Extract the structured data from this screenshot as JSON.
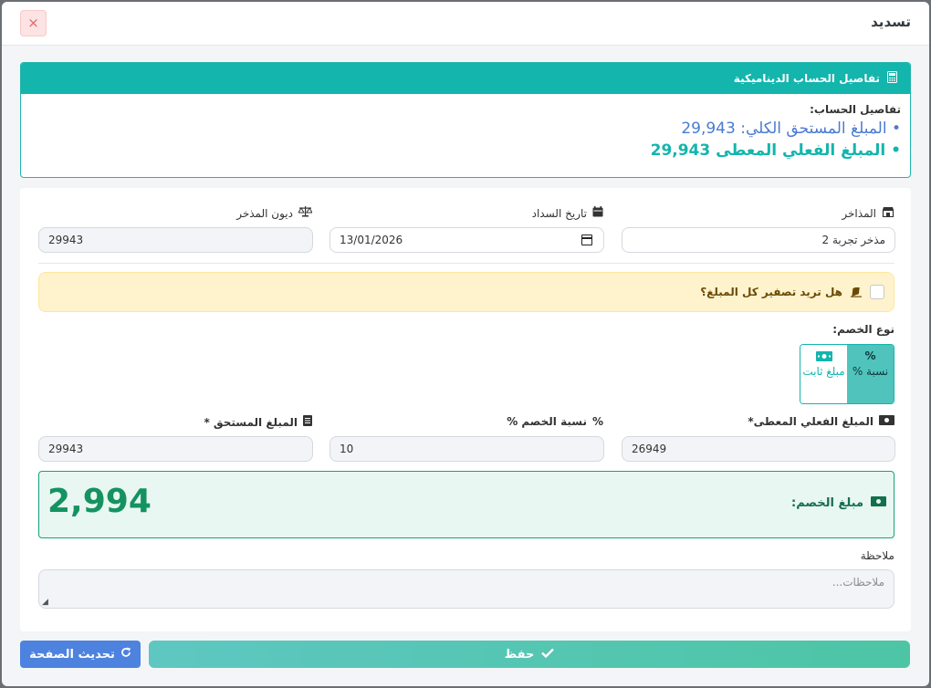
{
  "modal": {
    "title": "تسديد",
    "close_symbol": "×"
  },
  "calculation": {
    "header": "تفاصيل الحساب الديناميكية",
    "label": "تفاصيل الحساب:",
    "total_due_line": "• المبلغ المستحق الكلي: 29,943",
    "actual_given_line": "• المبلغ الفعلي المعطى 29,943"
  },
  "form": {
    "store": {
      "label": "المذاخر",
      "value": "مذخر تجربة 2"
    },
    "payment_date": {
      "label": "تاريخ السداد",
      "value": "13/01/2026"
    },
    "store_debts": {
      "label": "ديون المذخر",
      "value": "29943"
    },
    "zero_question": "هل تريد تصفير كل المبلغ؟",
    "discount_type": {
      "label": "نوع الخصم:",
      "options": [
        {
          "icon_text": "%",
          "label": "نسبة %",
          "active": true
        },
        {
          "icon_text": "▭",
          "label": "مبلغ ثابت",
          "active": false
        }
      ]
    },
    "actual_given": {
      "label": "المبلغ الفعلي المعطى*",
      "value": "26949"
    },
    "discount_percent": {
      "label": "نسبة الخصم %",
      "value": "10"
    },
    "amount_due": {
      "label": "المبلغ المستحق *",
      "value": "29943"
    },
    "discount_amount": {
      "label": "مبلغ الخصم:",
      "value": "2,994"
    },
    "notes": {
      "label": "ملاحظة",
      "placeholder": "ملاحظات..."
    }
  },
  "buttons": {
    "save": "حفظ",
    "refresh": "تحديث الصفحة"
  },
  "colors": {
    "teal": "#13b5ad",
    "green": "#149361",
    "blue": "#4d82df",
    "warning_bg": "#fff3cd"
  },
  "icons": [
    "calculator-icon",
    "store-icon",
    "calendar-icon",
    "scale-icon",
    "eraser-icon",
    "percent-icon",
    "money-icon",
    "file-icon",
    "check-icon",
    "refresh-icon"
  ]
}
